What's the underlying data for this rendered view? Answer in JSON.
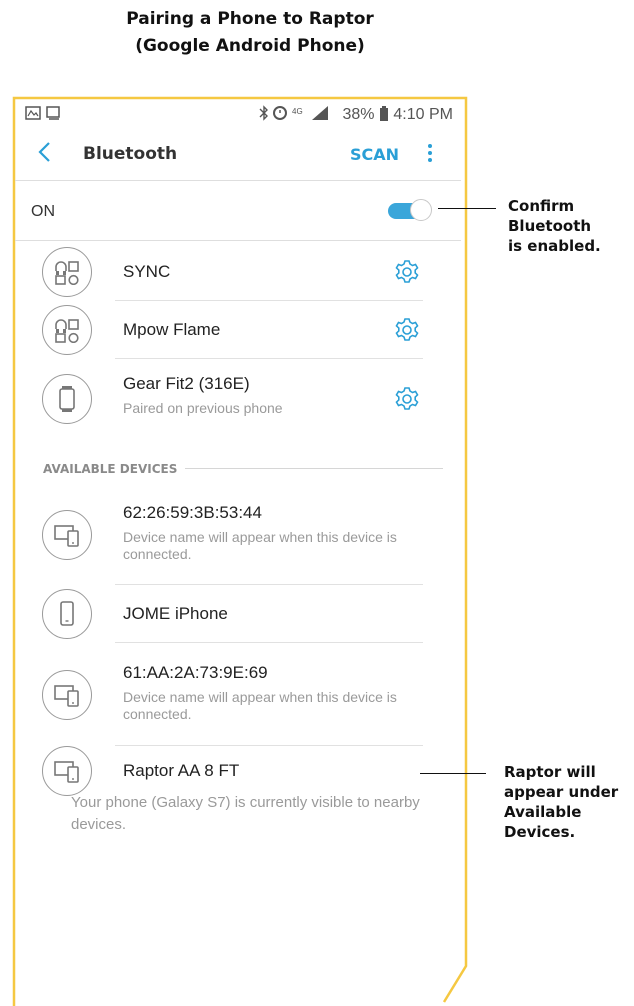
{
  "document_title": [
    "Pairing a Phone to Raptor",
    "(Google Android Phone)"
  ],
  "status_bar": {
    "left_icons": [
      "notification-icon",
      "screenshot-icon"
    ],
    "right_icons": [
      "bluetooth-icon",
      "alarm-icon",
      "lte-icon",
      "signal-icon"
    ],
    "battery": "38%",
    "time": "4:10 PM"
  },
  "app_bar": {
    "title": "Bluetooth",
    "scan_label": "SCAN"
  },
  "bluetooth_toggle": {
    "label": "ON",
    "state": "on"
  },
  "paired_devices": [
    {
      "name": "SYNC",
      "icon": "headset-device-icon"
    },
    {
      "name": "Mpow Flame",
      "icon": "headset-device-icon"
    },
    {
      "name": "Gear Fit2 (316E)",
      "subtitle": "Paired on previous phone",
      "icon": "watch-icon"
    }
  ],
  "available_section_title": "AVAILABLE DEVICES",
  "available_devices": [
    {
      "name": "62:26:59:3B:53:44",
      "subtitle": "Device name will appear when this device is connected.",
      "icon": "computer-phone-icon"
    },
    {
      "name": "JOME iPhone",
      "icon": "phone-icon"
    },
    {
      "name": "61:AA:2A:73:9E:69",
      "subtitle": "Device name will appear when this device is connected.",
      "icon": "computer-phone-icon"
    },
    {
      "name": "Raptor AA 8 FT",
      "icon": "computer-phone-icon"
    }
  ],
  "visibility_note": "Your phone (Galaxy S7) is currently visible to nearby devices.",
  "callouts": [
    {
      "lines": [
        "Confirm",
        "Bluetooth",
        "is enabled."
      ]
    },
    {
      "lines": [
        "Raptor will",
        "appear under",
        "Available",
        "Devices."
      ]
    }
  ],
  "colors": {
    "accent": "#2a9fd6",
    "frame": "#f5c842",
    "toggle": "#3aa6da"
  }
}
